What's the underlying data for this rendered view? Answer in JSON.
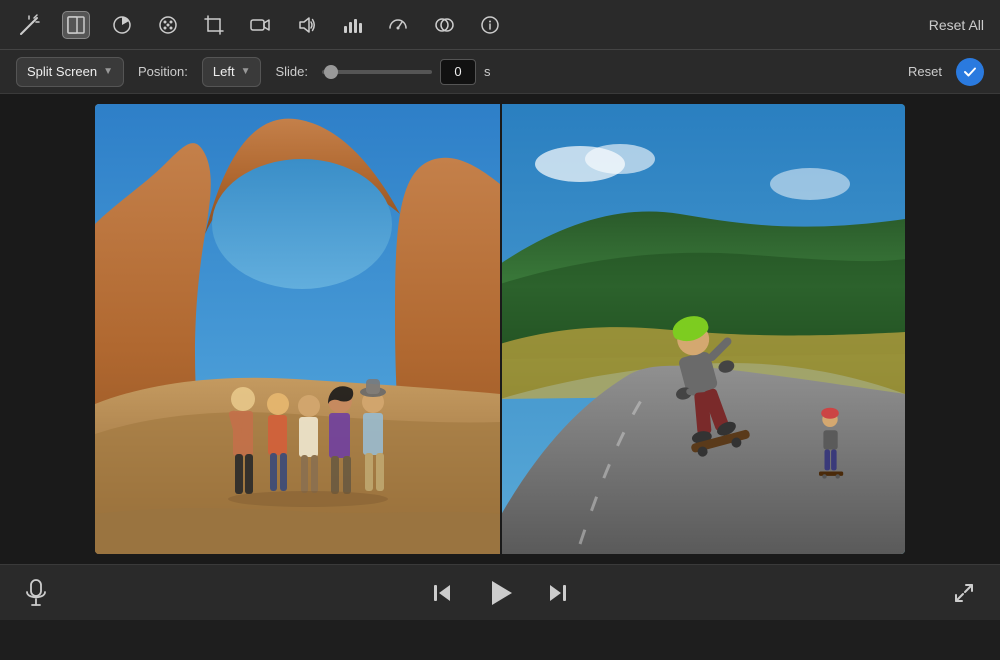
{
  "toolbar": {
    "reset_all_label": "Reset All",
    "icons": [
      {
        "name": "magic-wand-icon",
        "symbol": "✦"
      },
      {
        "name": "clip-icon",
        "symbol": "▣"
      },
      {
        "name": "color-wheel-icon",
        "symbol": "◑"
      },
      {
        "name": "palette-icon",
        "symbol": "🎨"
      },
      {
        "name": "crop-icon",
        "symbol": "⊠"
      },
      {
        "name": "video-icon",
        "symbol": "⬡"
      },
      {
        "name": "audio-icon",
        "symbol": "◈"
      },
      {
        "name": "bars-icon",
        "symbol": "▦"
      },
      {
        "name": "speed-icon",
        "symbol": "◎"
      },
      {
        "name": "overlay-icon",
        "symbol": "⬡"
      },
      {
        "name": "info-icon",
        "symbol": "ⓘ"
      }
    ]
  },
  "controls": {
    "effect_label": "Split Screen",
    "position_label": "Position:",
    "position_value": "Left",
    "slide_label": "Slide:",
    "slide_value": "0",
    "slide_unit": "s",
    "reset_label": "Reset"
  },
  "bottom": {
    "skip_back_label": "⏮",
    "play_label": "▶",
    "skip_forward_label": "⏭",
    "fullscreen_label": "⤢"
  }
}
